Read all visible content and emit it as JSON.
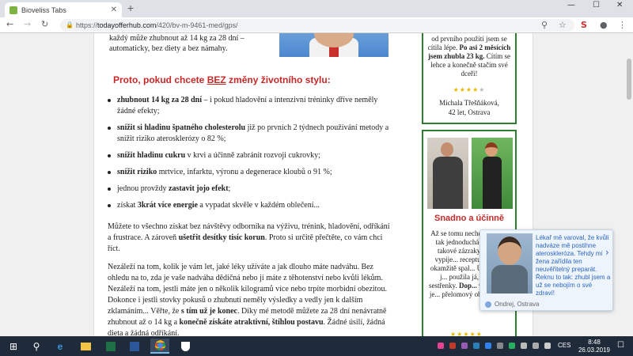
{
  "browser": {
    "tab_title": "Bioveliss Tabs",
    "tab_close": "✕",
    "new_tab": "+",
    "window_controls": [
      "—",
      "☐",
      "✕"
    ],
    "nav": {
      "back": "←",
      "forward": "→",
      "reload": "↻"
    },
    "url_scheme": "https://",
    "url_host": "todayofferhub.com",
    "url_path": "/420/bv-m-9461-med/gps/",
    "toolbar_icons": {
      "search": "⚲",
      "star": "☆",
      "ext": "S",
      "profile": "●",
      "menu": "⋮"
    }
  },
  "article": {
    "intro": "každý může zhubnout až 14 kg za 28 dní – automaticky, bez diety a bez námahy.",
    "heading_pre": "Proto, pokud chcete ",
    "heading_bold": "BEZ",
    "heading_post": " změny životního stylu:",
    "bullets": [
      {
        "bold": "zhubnout 14 kg za 28 dní",
        "rest": " – i pokud hladovění a intenzivní tréninky dříve neměly žádné efekty;"
      },
      {
        "bold": "snížit si hladinu špatného cholesterolu",
        "rest": " již po prvních 2 týdnech používání metody a snížit riziko aterosklerózy o 82 %;"
      },
      {
        "bold": "snížit hladinu cukru",
        "rest": " v krvi a účinně zabránit rozvoji cukrovky;"
      },
      {
        "bold": "snížit riziko",
        "rest": " mrtvice, infarktu, výronu a degenerace kloubů o 91 %;"
      },
      {
        "pre": "jednou provždy ",
        "bold": "zastavit jojo efekt",
        "rest": ";"
      },
      {
        "pre": "získat ",
        "bold": "3krát více energie",
        "rest": " a vypadat skvěle v každém oblečení..."
      }
    ],
    "p1_pre": "Můžete to všechno získat bez návštěvy odborníka na výživu, trénink, hladovění, odříkání a frustrace. A zároveň ",
    "p1_bold": "ušetřit desítky tisíc korun",
    "p1_post": ". Proto si určitě přečtěte, co vám chci říct.",
    "p2_a": "Nezáleží na tom, kolik je vám let, jaké léky užíváte a jak dlouho máte nadváhu. Bez ohledu na to, zda je vaše nadváha dědičná nebo jí máte z těhotenství nebo kvůli lékům. Nezáleží na tom, jestli máte jen o několik kilogramů více nebo trpíte morbidní obezitou. Dokonce i jestli stovky pokusů o zhubnutí neměly výsledky a vedly jen k dalším zklamáním... Věřte, že ",
    "p2_bold": "s tím už je konec",
    "p2_b": ". Díky mé metodě můžete za 28 dní nenávratně zhubnout až o 14 kg a ",
    "p2_bold2": "konečně získáte atraktivní, štíhlou postavu",
    "p2_c": ". Žádné úsilí, žádná dieta a žádná odříkání."
  },
  "sidebar": {
    "testimonial1_pre": "od prvního použití jsem se cítila lépe. ",
    "testimonial1_bold": "Po asi 2 měsících jsem zhubla 23 kg.",
    "testimonial1_post": " Cítím se lehce a konečně stačím své dceři!",
    "stars1": "★★★★",
    "stars1_off": "★",
    "author1_name": "Michala Třešňáková,",
    "author1_info": "42 let, Ostrava",
    "heading2": "Snadno a účinně",
    "text2_pre": "Až se tomu nechce věřit, že tak jednoduchá věc dělá takové zázraky! Prostě vypije... recepturu a za... okamžitě spal... Úžasné. Už j... použila já, moje... sestřenky. ",
    "text2_bold": "Dop... všem!",
    "text2_post": " Toto je... přelomový ob... hubnutí",
    "stars2": "★★★★★"
  },
  "popup": {
    "text": "Lékař mě varoval, že kvůli nadváze mě postihne ateroskleróza. Tehdy mi žena zařídila ten neuvěřitelný preparát. Řeknu to tak: zhubl jsem a už se nebojím o své zdraví!",
    "author": "Ondrej, Ostrava",
    "next": "›"
  },
  "taskbar": {
    "start": "⊞",
    "search": "⚲",
    "lang": "CES",
    "time": "8:48",
    "date": "26.03.2019",
    "notifications": "☐"
  }
}
